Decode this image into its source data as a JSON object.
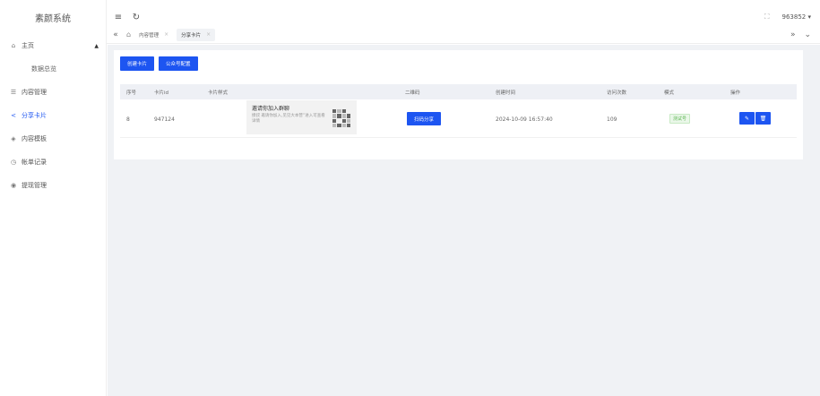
{
  "app": {
    "logo": "素颜系统"
  },
  "sidebar": {
    "items": [
      {
        "label": "主页",
        "icon": "home-icon"
      },
      {
        "label": "数据总览",
        "icon": ""
      },
      {
        "label": "内容管理",
        "icon": "list-icon"
      },
      {
        "label": "分享卡片",
        "icon": "share-icon"
      },
      {
        "label": "内容模板",
        "icon": "template-icon"
      },
      {
        "label": "帐单记录",
        "icon": "clock-icon"
      },
      {
        "label": "提现管理",
        "icon": "withdraw-icon"
      }
    ],
    "active_index": 3
  },
  "header": {
    "username": "963852"
  },
  "tabs": {
    "items": [
      {
        "label": "内容管理"
      },
      {
        "label": "分享卡片"
      }
    ]
  },
  "toolbar": {
    "create_label": "创建卡片",
    "config_label": "公众号配置"
  },
  "table": {
    "columns": [
      "序号",
      "卡片id",
      "卡片样式",
      "二维码",
      "创建时间",
      "访问次数",
      "模式",
      "操作"
    ],
    "rows": [
      {
        "no": "8",
        "id": "947124",
        "style_title": "邀请你加入群聊",
        "style_desc": "撩叔 邀请你加入,见见大本营”进入可查看详情",
        "qr_button": "扫码分享",
        "created": "2024-10-09 16:57:40",
        "visits": "109",
        "mode": "测试号"
      }
    ]
  },
  "colors": {
    "primary": "#1d55f1",
    "success_tag": "#61b857"
  }
}
